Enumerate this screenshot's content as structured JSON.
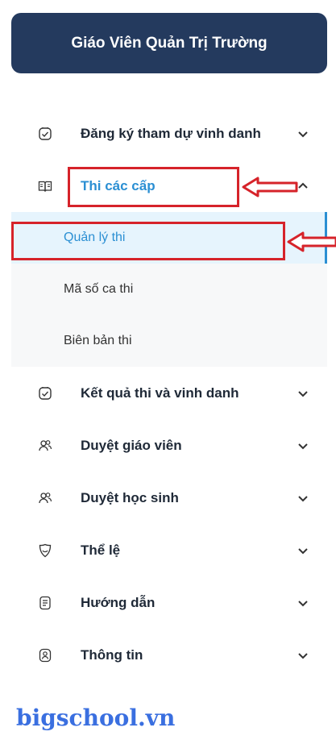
{
  "header": {
    "title": "Giáo Viên Quản Trị Trường"
  },
  "menu": {
    "items": [
      {
        "label": "Đăng ký tham dự vinh danh",
        "icon": "award-badge-icon"
      },
      {
        "label": "Thi các cấp",
        "icon": "open-book-icon",
        "expanded": true
      },
      {
        "label": "Kết quả thi và vinh danh",
        "icon": "award-badge-icon"
      },
      {
        "label": "Duyệt giáo viên",
        "icon": "users-icon"
      },
      {
        "label": "Duyệt học sinh",
        "icon": "users-icon"
      },
      {
        "label": "Thể lệ",
        "icon": "smile-shield-icon"
      },
      {
        "label": "Hướng dẫn",
        "icon": "document-icon"
      },
      {
        "label": "Thông tin",
        "icon": "user-badge-icon"
      }
    ],
    "submenu": [
      {
        "label": "Quản lý thi",
        "selected": true
      },
      {
        "label": "Mã số ca thi"
      },
      {
        "label": "Biên bản thi"
      }
    ]
  },
  "colors": {
    "header_bg": "#243a5e",
    "accent": "#2b8fd3",
    "highlight": "#d6232a",
    "watermark": "#3a6fe0"
  },
  "watermark": "bigschool.vn"
}
